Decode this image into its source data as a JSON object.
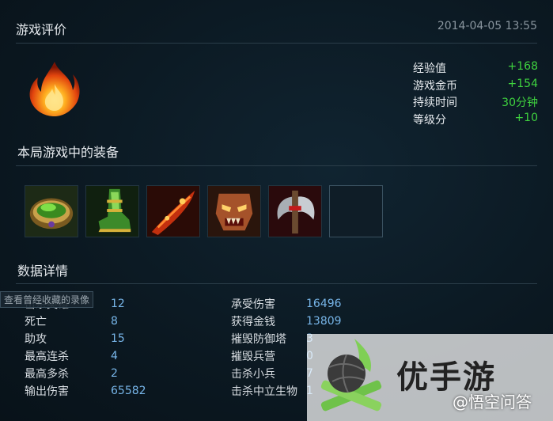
{
  "header": {
    "title": "游戏评价",
    "timestamp": "2014-04-05 13:55"
  },
  "rewards": [
    {
      "label": "经验值",
      "value": "+168"
    },
    {
      "label": "游戏金币",
      "value": "+154"
    },
    {
      "label": "持续时间",
      "value": "30分钟"
    },
    {
      "label": "等级分",
      "value": "+10"
    }
  ],
  "equipment": {
    "title": "本局游戏中的装备",
    "items": [
      "item-green-ring-icon",
      "item-green-boots-icon",
      "item-flame-blade-icon",
      "item-demon-mask-icon",
      "item-battle-axe-icon",
      "empty-slot"
    ]
  },
  "details": {
    "title": "数据详情",
    "replay_tip": "查看曾经收藏的录像",
    "left": [
      {
        "label": "击杀英雄",
        "value": "12"
      },
      {
        "label": "死亡",
        "value": "8"
      },
      {
        "label": "助攻",
        "value": "15"
      },
      {
        "label": "最高连杀",
        "value": "4"
      },
      {
        "label": "最高多杀",
        "value": "2"
      },
      {
        "label": "输出伤害",
        "value": "65582"
      }
    ],
    "right": [
      {
        "label": "承受伤害",
        "value": "16496"
      },
      {
        "label": "获得金钱",
        "value": "13809"
      },
      {
        "label": "摧毁防御塔",
        "value": "3"
      },
      {
        "label": "摧毁兵营",
        "value": "0"
      },
      {
        "label": "击杀小兵",
        "value": "7"
      },
      {
        "label": "击杀中立生物",
        "value": "1"
      }
    ]
  },
  "watermark": {
    "brand": "优手游",
    "sub": "@悟空问答"
  },
  "colors": {
    "positive": "#3fd33f",
    "value_blue": "#77b5e8",
    "background": "#0d1a24"
  }
}
